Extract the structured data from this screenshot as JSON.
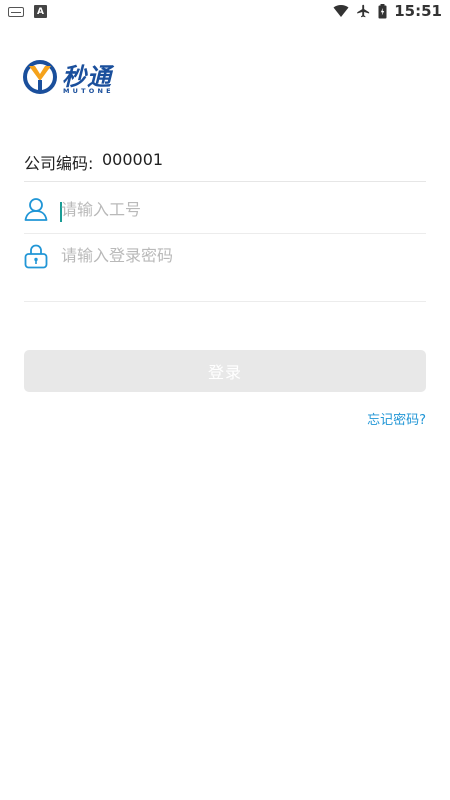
{
  "status_bar": {
    "keyboard_icon": "keyboard-icon",
    "notification_icon": "a-icon",
    "notification_letter": "A",
    "time": "15:51"
  },
  "logo": {
    "name_cn": "秒通",
    "name_en": "MUTONE"
  },
  "company": {
    "label": "公司编码:",
    "value": "000001"
  },
  "user_field": {
    "icon": "user-icon",
    "placeholder": "请输入工号",
    "value": ""
  },
  "password_field": {
    "icon": "lock-icon",
    "placeholder": "请输入登录密码",
    "value": ""
  },
  "login_button": {
    "label": "登录"
  },
  "forgot_password": {
    "label": "忘记密码?"
  },
  "colors": {
    "brand_blue": "#1a4f9c",
    "accent_blue": "#2196d6",
    "logo_orange": "#f5a21b",
    "button_disabled": "#e8e8e8"
  }
}
